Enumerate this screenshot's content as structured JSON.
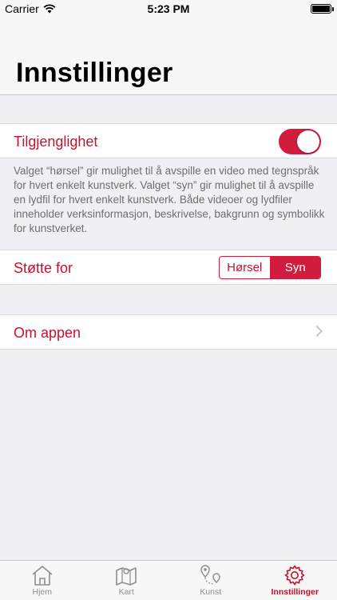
{
  "status_bar": {
    "carrier": "Carrier",
    "time": "5:23 PM"
  },
  "page": {
    "title": "Innstillinger"
  },
  "accessibility": {
    "label": "Tilgjenglighet",
    "enabled": true,
    "description": "Valget “hørsel” gir mulighet til å avspille en video med tegnspråk for hvert enkelt kunstverk. Valget “syn” gir mulighet til å avspille en lydfil for hvert enkelt kunstverk. Både videoer og lydfiler inneholder verksinformasjon, beskrivelse, bakgrunn og symbolikk for kunstverket."
  },
  "support": {
    "label": "Støtte for",
    "options": [
      "Hørsel",
      "Syn"
    ],
    "selected": "Syn"
  },
  "about": {
    "label": "Om appen"
  },
  "tabs": [
    {
      "label": "Hjem",
      "icon": "home-icon"
    },
    {
      "label": "Kart",
      "icon": "map-icon"
    },
    {
      "label": "Kunst",
      "icon": "route-pin-icon"
    },
    {
      "label": "Innstillinger",
      "icon": "gear-icon",
      "active": true
    }
  ],
  "colors": {
    "accent": "#c8102e",
    "toggle_on": "#d21c3e",
    "background": "#efeff4"
  }
}
